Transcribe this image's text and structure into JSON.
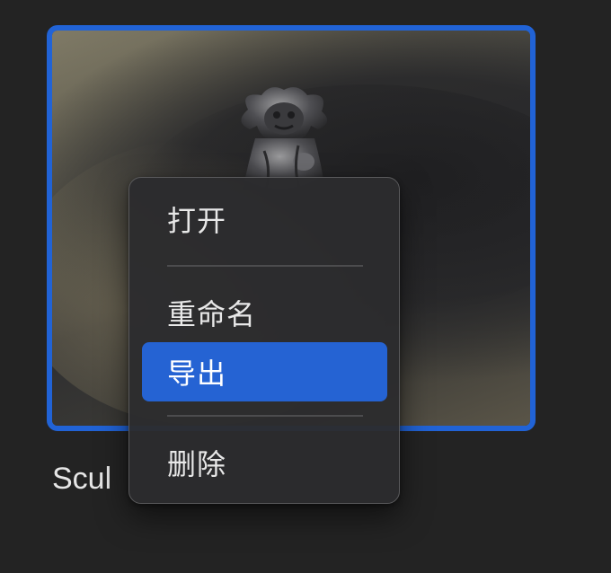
{
  "file": {
    "name_visible": "Scul"
  },
  "context_menu": {
    "items": [
      {
        "label": "打开",
        "highlighted": false
      },
      {
        "label": "重命名",
        "highlighted": false
      },
      {
        "label": "导出",
        "highlighted": true
      },
      {
        "label": "删除",
        "highlighted": false
      }
    ]
  },
  "colors": {
    "background": "#232323",
    "selection_border": "#2163d6",
    "menu_background": "#2c2c2e",
    "menu_highlight": "#2563d3"
  },
  "icons": {
    "thumbnail": "stone-lion-statue-thumbnail"
  }
}
